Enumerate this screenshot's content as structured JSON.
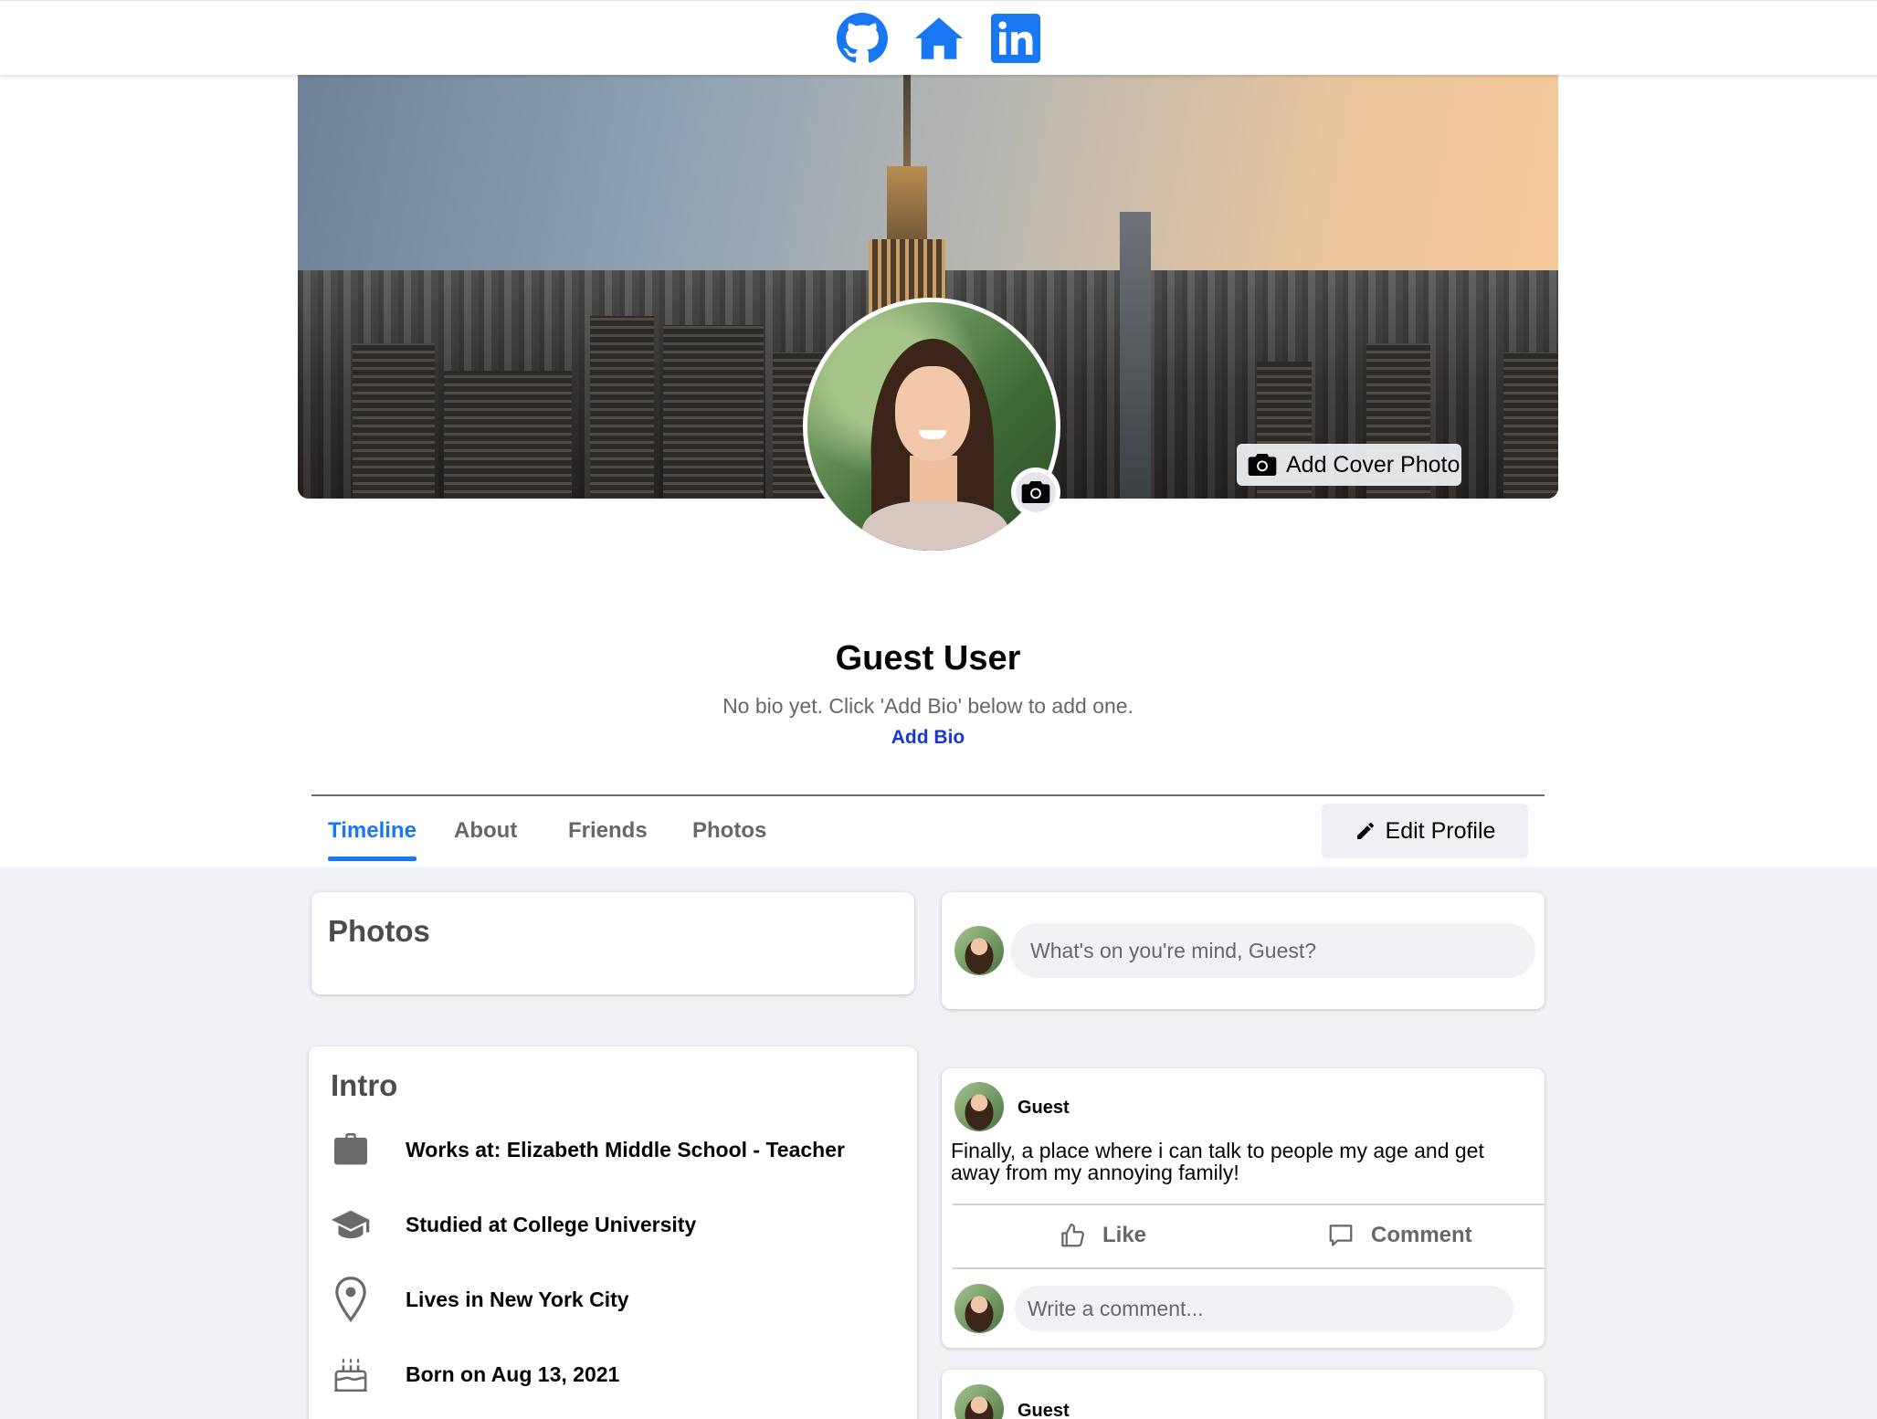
{
  "nav": {
    "icons": [
      "github-icon",
      "home-icon",
      "linkedin-icon"
    ],
    "accent": "#1877f2"
  },
  "cover": {
    "add_cover_label": "Add Cover Photo"
  },
  "profile": {
    "name": "Guest User",
    "bio": "No bio yet. Click 'Add Bio' below to add one.",
    "add_bio_label": "Add Bio"
  },
  "tabs": {
    "items": [
      {
        "label": "Timeline",
        "active": true
      },
      {
        "label": "About",
        "active": false
      },
      {
        "label": "Friends",
        "active": false
      },
      {
        "label": "Photos",
        "active": false
      }
    ],
    "edit_profile_label": "Edit Profile"
  },
  "photos_card": {
    "title": "Photos"
  },
  "intro": {
    "title": "Intro",
    "items": [
      {
        "icon": "briefcase-icon",
        "text": "Works at: Elizabeth Middle School - Teacher"
      },
      {
        "icon": "graduation-cap-icon",
        "text": "Studied at College University"
      },
      {
        "icon": "location-pin-icon",
        "text": "Lives in New York City"
      },
      {
        "icon": "birthday-cake-icon",
        "text": "Born on Aug 13, 2021"
      }
    ]
  },
  "composer": {
    "placeholder": "What's on you're mind, Guest?"
  },
  "posts": [
    {
      "author": "Guest",
      "text": "Finally, a place where i can talk to people my age and get away from my annoying family!",
      "like_label": "Like",
      "comment_label": "Comment",
      "comment_placeholder": "Write a comment..."
    },
    {
      "author": "Guest"
    }
  ]
}
